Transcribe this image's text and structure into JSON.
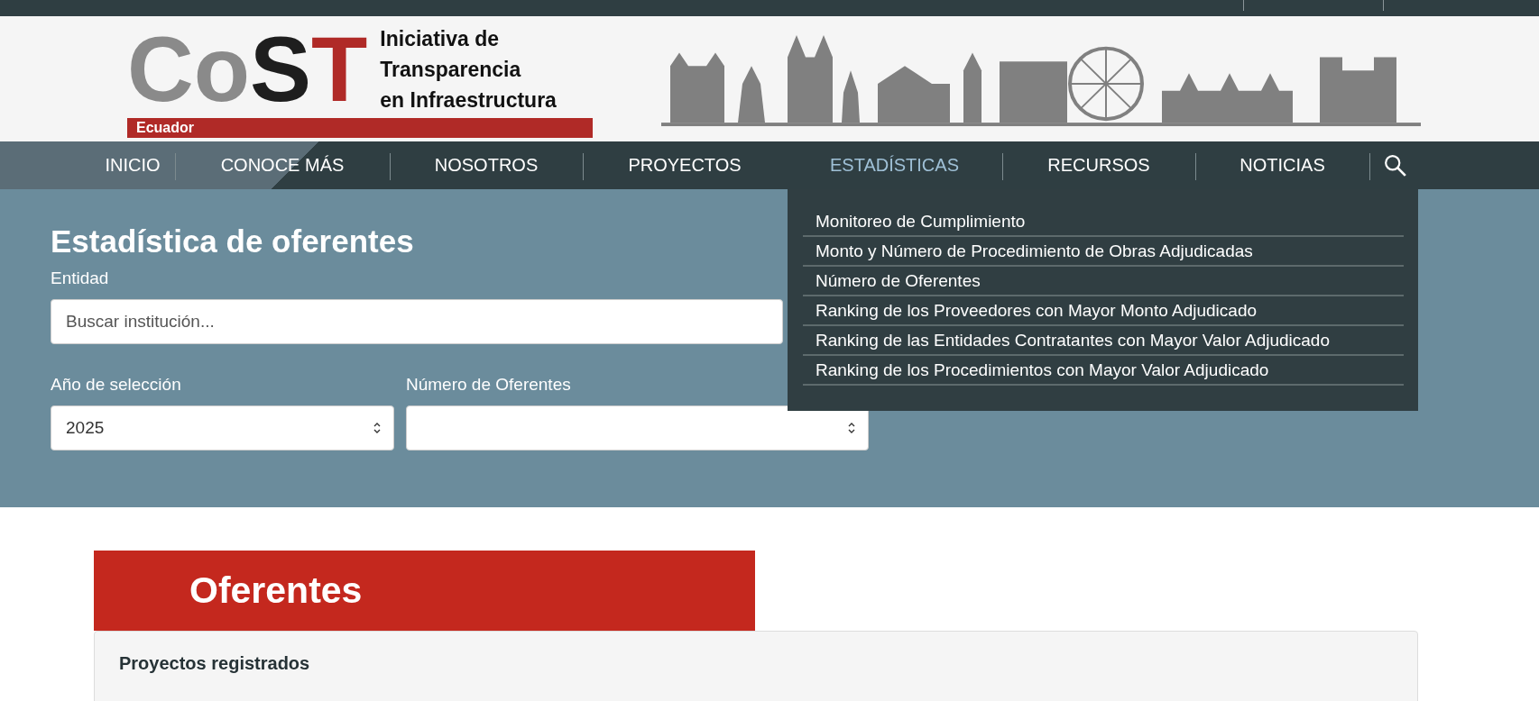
{
  "logo": {
    "letters": [
      {
        "text": "Co",
        "color": "#8a8a8a"
      },
      {
        "text": "S",
        "color": "#1e1e1e"
      },
      {
        "text": "T",
        "color": "#b02a27"
      }
    ],
    "tagline": [
      "Iniciativa de",
      "Transparencia",
      "en Infraestructura"
    ],
    "country": "Ecuador"
  },
  "nav": {
    "items": [
      {
        "label": "INICIO",
        "selected": false
      },
      {
        "label": "CONOCE MÁS",
        "selected": false
      },
      {
        "label": "NOSOTROS",
        "selected": false
      },
      {
        "label": "PROYECTOS",
        "selected": false
      },
      {
        "label": "ESTADÍSTICAS",
        "selected": true,
        "submenu": [
          "Monitoreo de Cumplimiento",
          "Monto y Número de Procedimiento de Obras Adjudicadas",
          "Número de Oferentes",
          "Ranking de los Proveedores con Mayor Monto Adjudicado",
          "Ranking de las Entidades Contratantes con Mayor Valor Adjudicado",
          "Ranking de los Procedimientos con Mayor Valor Adjudicado"
        ]
      },
      {
        "label": "RECURSOS",
        "selected": false
      },
      {
        "label": "NOTICIAS",
        "selected": false
      }
    ]
  },
  "filters": {
    "title": "Estadística de oferentes",
    "entity": {
      "label": "Entidad",
      "placeholder": "Buscar institución..."
    },
    "year": {
      "label": "Año de selección",
      "value": "2025"
    },
    "bidders": {
      "label": "Número de Oferentes"
    }
  },
  "section": {
    "title": "Oferentes",
    "card_title": "Proyectos registrados"
  }
}
